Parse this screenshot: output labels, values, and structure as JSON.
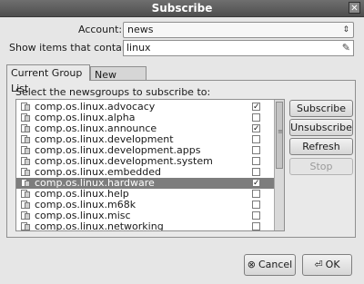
{
  "window": {
    "title": "Subscribe"
  },
  "account": {
    "label": "Account:",
    "value": "news"
  },
  "filter": {
    "label": "Show items that contain:",
    "value": "linux"
  },
  "tabs": [
    {
      "label": "Current Group List",
      "active": true
    },
    {
      "label": "New Groups",
      "active": false
    }
  ],
  "list_label": "Select the newsgroups to subscribe to:",
  "newsgroups": [
    {
      "name": "comp.os.linux.advocacy",
      "checked": true,
      "selected": false
    },
    {
      "name": "comp.os.linux.alpha",
      "checked": false,
      "selected": false
    },
    {
      "name": "comp.os.linux.announce",
      "checked": true,
      "selected": false
    },
    {
      "name": "comp.os.linux.development",
      "checked": false,
      "selected": false
    },
    {
      "name": "comp.os.linux.development.apps",
      "checked": false,
      "selected": false
    },
    {
      "name": "comp.os.linux.development.system",
      "checked": false,
      "selected": false
    },
    {
      "name": "comp.os.linux.embedded",
      "checked": false,
      "selected": false
    },
    {
      "name": "comp.os.linux.hardware",
      "checked": true,
      "selected": true
    },
    {
      "name": "comp.os.linux.help",
      "checked": false,
      "selected": false
    },
    {
      "name": "comp.os.linux.m68k",
      "checked": false,
      "selected": false
    },
    {
      "name": "comp.os.linux.misc",
      "checked": false,
      "selected": false
    },
    {
      "name": "comp.os.linux.networking",
      "checked": false,
      "selected": false
    }
  ],
  "side_buttons": {
    "subscribe": "Subscribe",
    "unsubscribe": "Unsubscribe",
    "refresh": "Refresh",
    "stop": "Stop"
  },
  "footer": {
    "cancel": "Cancel",
    "ok": "OK"
  },
  "icons": {
    "close": "close-icon",
    "combo_arrows": "updown-arrows-icon",
    "clear": "clear-icon",
    "newsgroup": "newsgroup-icon",
    "cancel": "cancel-icon",
    "ok": "ok-icon"
  },
  "colors": {
    "selection": "#7d7d7d",
    "titlebar": "#5a5a5a"
  }
}
